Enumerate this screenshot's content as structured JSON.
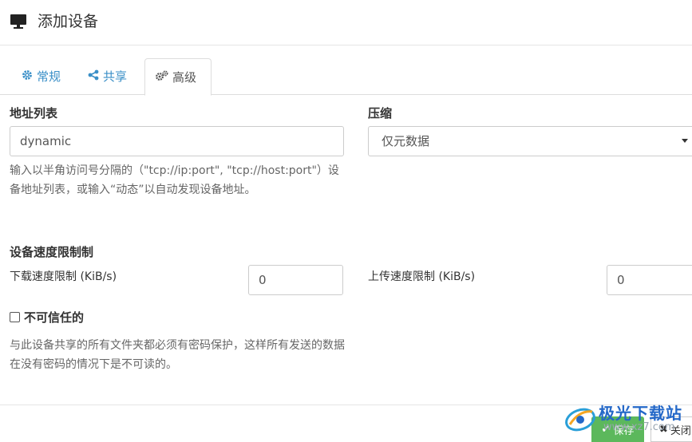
{
  "dialog": {
    "title": "添加设备",
    "title_icon": "monitor-icon"
  },
  "tabs": [
    {
      "label": "常规",
      "icon": "gear-icon",
      "active": false
    },
    {
      "label": "共享",
      "icon": "share-icon",
      "active": false
    },
    {
      "label": "高级",
      "icon": "gears-icon",
      "active": true
    }
  ],
  "addresses": {
    "label": "地址列表",
    "value": "dynamic",
    "help": "输入以半角访问号分隔的（\"tcp://ip:port\", \"tcp://host:port\"）设备地址列表，或输入“动态”以自动发现设备地址。"
  },
  "compression": {
    "label": "压缩",
    "selected": "仅元数据"
  },
  "rate_limits": {
    "heading": "设备速度限制制",
    "download_label": "下载速度限制 (KiB/s)",
    "download_value": "0",
    "upload_label": "上传速度限制 (KiB/s)",
    "upload_value": "0"
  },
  "untrusted": {
    "label": "不可信任的",
    "checked": false,
    "help": "与此设备共享的所有文件夹都必须有密码保护，这样所有发送的数据在没有密码的情况下是不可读的。"
  },
  "footer": {
    "save_label": "保存",
    "close_label": "关闭"
  },
  "watermark": {
    "text": "极光下载站",
    "url": "www.xz7.com"
  },
  "colors": {
    "link": "#3a8fc7",
    "save_button": "#5cb85c",
    "watermark": "#2468c8"
  }
}
